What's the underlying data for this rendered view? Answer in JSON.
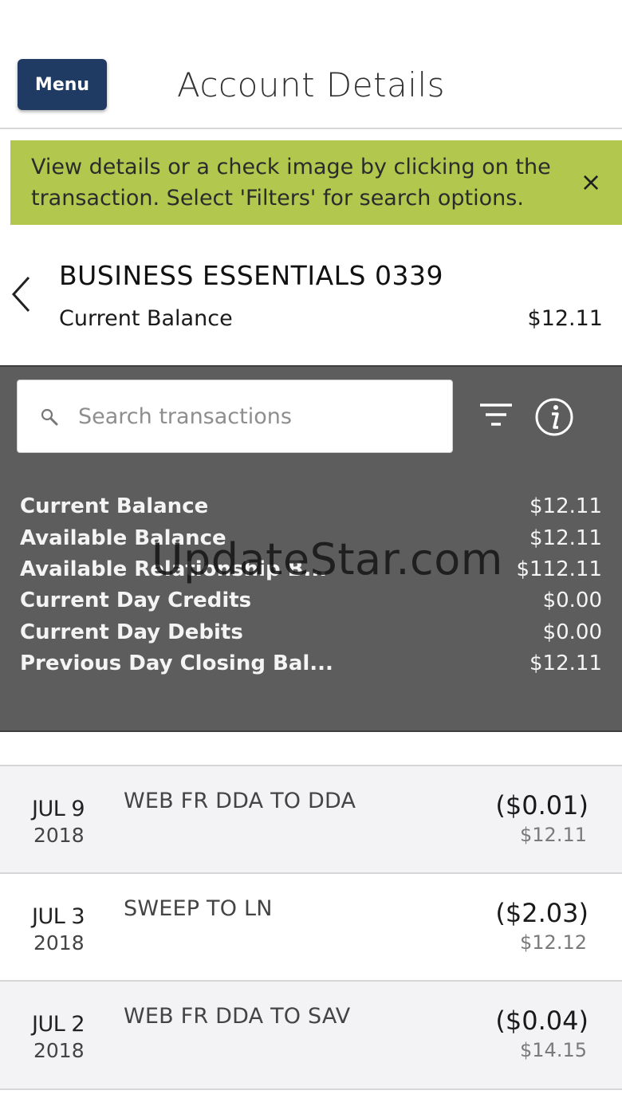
{
  "header": {
    "menu_label": "Menu",
    "title": "Account Details"
  },
  "banner": {
    "message": "View details or a check image by clicking on the transaction. Select 'Filters' for search options.",
    "close_glyph": "×"
  },
  "account": {
    "name": "BUSINESS ESSENTIALS 0339",
    "balance_label": "Current Balance",
    "balance_value": "$12.11"
  },
  "search": {
    "placeholder": "Search transactions"
  },
  "balances": [
    {
      "label": "Current Balance",
      "value": "$12.11"
    },
    {
      "label": "Available Balance",
      "value": "$12.11"
    },
    {
      "label": "Available Relationship B...",
      "value": "$112.11"
    },
    {
      "label": "Current Day Credits",
      "value": "$0.00"
    },
    {
      "label": "Current Day Debits",
      "value": "$0.00"
    },
    {
      "label": "Previous Day Closing Bal...",
      "value": "$12.11"
    }
  ],
  "watermark": "UpdateStar.com",
  "transactions": [
    {
      "date": "JUL 9",
      "year": "2018",
      "description": "WEB FR DDA TO DDA",
      "amount": "($0.01)",
      "running_balance": "$12.11"
    },
    {
      "date": "JUL 3",
      "year": "2018",
      "description": "SWEEP TO LN",
      "amount": "($2.03)",
      "running_balance": "$12.12"
    },
    {
      "date": "JUL 2",
      "year": "2018",
      "description": "WEB FR DDA TO SAV",
      "amount": "($0.04)",
      "running_balance": "$14.15"
    }
  ],
  "colors": {
    "menu_bg": "#1f3b63",
    "banner_bg": "#b1c74e",
    "panel_bg": "#5d5d5d"
  }
}
